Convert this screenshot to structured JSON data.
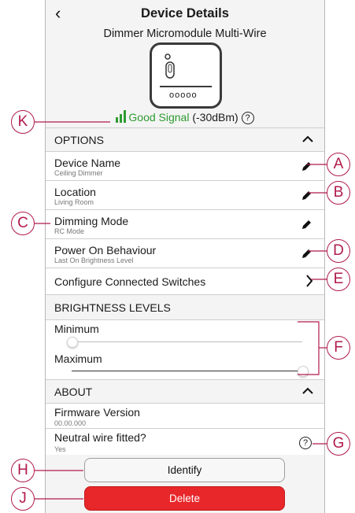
{
  "header": {
    "title": "Device Details",
    "subtitle": "Dimmer Micromodule Multi-Wire",
    "device_dots": "ooooo"
  },
  "signal": {
    "quality": "Good Signal",
    "strength": "(-30dBm)",
    "help": "?"
  },
  "options": {
    "section_title": "OPTIONS",
    "device_name": {
      "label": "Device Name",
      "value": "Ceiling Dimmer"
    },
    "location": {
      "label": "Location",
      "value": "Living Room"
    },
    "dimming_mode": {
      "label": "Dimming Mode",
      "value": "RC Mode"
    },
    "power_on": {
      "label": "Power On Behaviour",
      "value": "Last On Brightness Level"
    },
    "connected_switches": {
      "label": "Configure Connected Switches"
    }
  },
  "brightness": {
    "section_title": "BRIGHTNESS LEVELS",
    "minimum": {
      "label": "Minimum",
      "level": 0
    },
    "maximum": {
      "label": "Maximum",
      "level": 1
    }
  },
  "about": {
    "section_title": "ABOUT",
    "firmware": {
      "label": "Firmware Version",
      "value": "00.00.000"
    },
    "neutral": {
      "label": "Neutral wire fitted?",
      "value": "Yes",
      "help": "?"
    }
  },
  "buttons": {
    "identify": "Identify",
    "delete": "Delete"
  },
  "callouts": {
    "a": "A",
    "b": "B",
    "c": "C",
    "d": "D",
    "e": "E",
    "f": "F",
    "g": "G",
    "h": "H",
    "j": "J",
    "k": "K"
  },
  "colors": {
    "signal_green": "#2e9b31",
    "delete_red": "#e8272a",
    "callout": "#b01a4a"
  }
}
